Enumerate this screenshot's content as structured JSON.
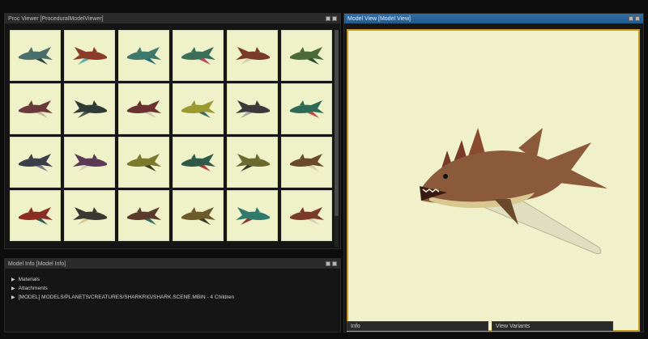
{
  "proc_viewer": {
    "title": "Proc Viewer  [ProceduralModelViewer]"
  },
  "model_view": {
    "title": "Model View  [Model View]",
    "info_label": "Info",
    "variants_label": "View Variants"
  },
  "model_info": {
    "title": "Model Info  [Model Info]",
    "items": [
      {
        "label": "Materials"
      },
      {
        "label": "Attachments"
      },
      {
        "label": "[MODEL] MODELS/PLANETS/CREATURES/SHARKRIG/SHARK.SCENE.MBIN - 4 Children"
      }
    ]
  },
  "colors": {
    "accent_blue": "#2e6fa8",
    "viewport_border": "#c79a21",
    "thumb_bg": "#eff1c9"
  },
  "thumbnails": [
    {
      "icon": "shark-variant-icon",
      "body": "#4a6f6b",
      "fin": "#2f4a45"
    },
    {
      "icon": "shark-variant-icon",
      "body": "#8a3b2a",
      "fin": "#5ab0a0"
    },
    {
      "icon": "shark-variant-icon",
      "body": "#3e7a6c",
      "fin": "#2d6a72"
    },
    {
      "icon": "shark-variant-icon",
      "body": "#3c6f57",
      "fin": "#c0485c"
    },
    {
      "icon": "shark-variant-icon",
      "body": "#7a3a2a",
      "fin": "#d8d0a8"
    },
    {
      "icon": "shark-variant-icon",
      "body": "#4b6a3a",
      "fin": "#2f4a30"
    },
    {
      "icon": "shark-variant-icon",
      "body": "#6a3a3a",
      "fin": "#c8b8a0"
    },
    {
      "icon": "shark-variant-icon",
      "body": "#2e3b36",
      "fin": "#45574f"
    },
    {
      "icon": "shark-variant-icon",
      "body": "#6b3131",
      "fin": "#d0c8a8"
    },
    {
      "icon": "shark-variant-icon",
      "body": "#9a9a30",
      "fin": "#3a6a62"
    },
    {
      "icon": "shark-variant-icon",
      "body": "#3a3a3a",
      "fin": "#a8a8a0"
    },
    {
      "icon": "shark-variant-icon",
      "body": "#2f6a56",
      "fin": "#c04848"
    },
    {
      "icon": "shark-variant-icon",
      "body": "#3a3f4a",
      "fin": "#7a7f8a"
    },
    {
      "icon": "shark-variant-icon",
      "body": "#5a3a55",
      "fin": "#d8cfc0"
    },
    {
      "icon": "shark-variant-icon",
      "body": "#7a7a2a",
      "fin": "#3a3a20"
    },
    {
      "icon": "shark-variant-icon",
      "body": "#2f5a4a",
      "fin": "#b03a3a"
    },
    {
      "icon": "shark-variant-icon",
      "body": "#6a6a30",
      "fin": "#3a3a2a"
    },
    {
      "icon": "shark-variant-icon",
      "body": "#6a4a2a",
      "fin": "#d8cfa0"
    },
    {
      "icon": "shark-variant-icon",
      "body": "#8a2e25",
      "fin": "#2f5a52"
    },
    {
      "icon": "shark-variant-icon",
      "body": "#3a3a30",
      "fin": "#d8c890"
    },
    {
      "icon": "shark-variant-icon",
      "body": "#5a3a2a",
      "fin": "#2f6a5a"
    },
    {
      "icon": "shark-variant-icon",
      "body": "#6b5a2a",
      "fin": "#3a3a2a"
    },
    {
      "icon": "shark-variant-icon",
      "body": "#2f7a6a",
      "fin": "#8a3a3a"
    },
    {
      "icon": "shark-variant-icon",
      "body": "#7a3a2a",
      "fin": "#d8cfb8"
    }
  ],
  "big_model": {
    "icon": "shark-model-icon",
    "body": "#8a5a3a",
    "belly": "#d8c890",
    "fin": "#e0ddc0"
  }
}
